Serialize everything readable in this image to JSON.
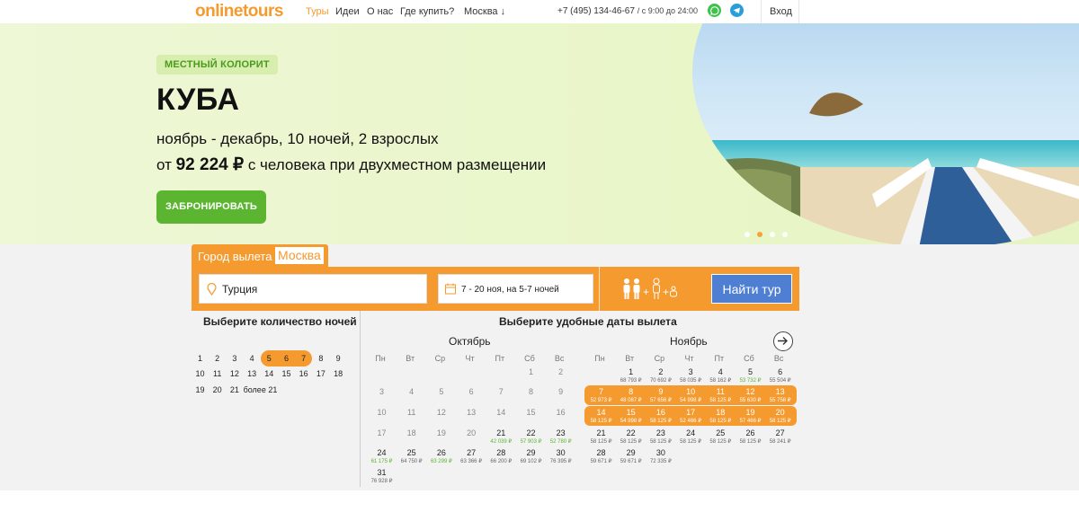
{
  "header": {
    "logo": "onlinetours",
    "nav": [
      "Туры",
      "Идеи",
      "О нас",
      "Где купить?"
    ],
    "city": "Москва ↓",
    "phone": "+7 (495) 134-46-67",
    "hours": "/ с 9:00 до 24:00",
    "login": "Вход"
  },
  "hero": {
    "badge": "МЕСТНЫЙ КОЛОРИТ",
    "title": "КУБА",
    "subtitle": "ноябрь - декабрь, 10 ночей, 2 взрослых",
    "price_prefix": "от",
    "price": "92 224 ₽",
    "price_suffix": "с человека при двухместном размещении",
    "cta": "ЗАБРОНИРОВАТЬ"
  },
  "search": {
    "departure_label": "Город вылета",
    "departure_city": "Москва",
    "country": "Турция",
    "dates": "7 - 20 ноя, на 5-7 ночей",
    "pax": "+",
    "submit": "Найти тур"
  },
  "nights": {
    "title": "Выберите количество ночей",
    "row1": [
      "1",
      "2",
      "3",
      "4",
      "5",
      "6",
      "7",
      "8",
      "9"
    ],
    "row2": [
      "10",
      "11",
      "12",
      "13",
      "14",
      "15",
      "16",
      "17",
      "18"
    ],
    "row3": [
      "19",
      "20",
      "21",
      "более 21"
    ]
  },
  "calendar": {
    "title": "Выберите удобные даты вылета",
    "weekdays": [
      "Пн",
      "Вт",
      "Ср",
      "Чт",
      "Пт",
      "Сб",
      "Вс"
    ],
    "october": {
      "name": "Октябрь",
      "days": [
        {
          "d": "1",
          "p": ""
        },
        {
          "d": "2",
          "p": ""
        },
        {
          "d": "3",
          "p": ""
        },
        {
          "d": "4",
          "p": ""
        },
        {
          "d": "5",
          "p": ""
        },
        {
          "d": "6",
          "p": ""
        },
        {
          "d": "7",
          "p": ""
        },
        {
          "d": "8",
          "p": ""
        },
        {
          "d": "9",
          "p": ""
        },
        {
          "d": "10",
          "p": ""
        },
        {
          "d": "11",
          "p": ""
        },
        {
          "d": "12",
          "p": ""
        },
        {
          "d": "13",
          "p": ""
        },
        {
          "d": "14",
          "p": ""
        },
        {
          "d": "15",
          "p": ""
        },
        {
          "d": "16",
          "p": ""
        },
        {
          "d": "17",
          "p": ""
        },
        {
          "d": "18",
          "p": ""
        },
        {
          "d": "19",
          "p": ""
        },
        {
          "d": "20",
          "p": ""
        },
        {
          "d": "21",
          "p": "42 039 ₽"
        },
        {
          "d": "22",
          "p": "57 903 ₽"
        },
        {
          "d": "23",
          "p": "52 780 ₽"
        },
        {
          "d": "24",
          "p": "61 175 ₽"
        },
        {
          "d": "25",
          "p": "64 750 ₽"
        },
        {
          "d": "26",
          "p": "63 299 ₽"
        },
        {
          "d": "27",
          "p": "63 366 ₽"
        },
        {
          "d": "28",
          "p": "66 200 ₽"
        },
        {
          "d": "29",
          "p": "69 102 ₽"
        },
        {
          "d": "30",
          "p": "76 395 ₽"
        },
        {
          "d": "31",
          "p": "76 928 ₽"
        }
      ]
    },
    "november": {
      "name": "Ноябрь",
      "days": [
        {
          "d": "1",
          "p": "68 793 ₽"
        },
        {
          "d": "2",
          "p": "70 692 ₽"
        },
        {
          "d": "3",
          "p": "58 035 ₽"
        },
        {
          "d": "4",
          "p": "58 162 ₽"
        },
        {
          "d": "5",
          "p": "53 732 ₽"
        },
        {
          "d": "6",
          "p": "55 504 ₽"
        },
        {
          "d": "7",
          "p": "52 973 ₽"
        },
        {
          "d": "8",
          "p": "48 087 ₽"
        },
        {
          "d": "9",
          "p": "57 656 ₽"
        },
        {
          "d": "10",
          "p": "54 998 ₽"
        },
        {
          "d": "11",
          "p": "58 125 ₽"
        },
        {
          "d": "12",
          "p": "55 630 ₽"
        },
        {
          "d": "13",
          "p": "55 758 ₽"
        },
        {
          "d": "14",
          "p": "58 125 ₽"
        },
        {
          "d": "15",
          "p": "54 998 ₽"
        },
        {
          "d": "16",
          "p": "58 125 ₽"
        },
        {
          "d": "17",
          "p": "52 466 ₽"
        },
        {
          "d": "18",
          "p": "58 125 ₽"
        },
        {
          "d": "19",
          "p": "57 466 ₽"
        },
        {
          "d": "20",
          "p": "58 125 ₽"
        },
        {
          "d": "21",
          "p": "58 125 ₽"
        },
        {
          "d": "22",
          "p": "58 125 ₽"
        },
        {
          "d": "23",
          "p": "58 125 ₽"
        },
        {
          "d": "24",
          "p": "58 125 ₽"
        },
        {
          "d": "25",
          "p": "58 125 ₽"
        },
        {
          "d": "26",
          "p": "58 125 ₽"
        },
        {
          "d": "27",
          "p": "58 241 ₽"
        },
        {
          "d": "28",
          "p": "59 671 ₽"
        },
        {
          "d": "29",
          "p": "59 671 ₽"
        },
        {
          "d": "30",
          "p": "72 335 ₽"
        }
      ]
    }
  },
  "colors": {
    "accent": "#f59a2e",
    "green": "#5cb531",
    "blue": "#4f7fd3"
  }
}
